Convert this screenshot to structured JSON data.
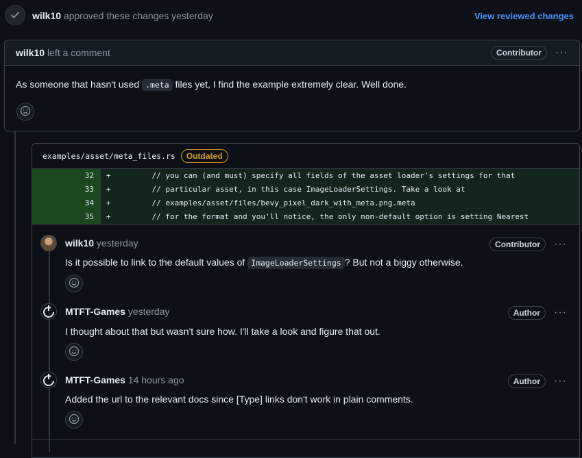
{
  "header": {
    "user": "wilk10",
    "action": "approved these changes yesterday",
    "view_link": "View reviewed changes"
  },
  "top_comment": {
    "user": "wilk10",
    "action": "left a comment",
    "badge": "Contributor",
    "text_before": "As someone that hasn't used",
    "code": ".meta",
    "text_after": "files yet, I find the example extremely clear. Well done."
  },
  "thread": {
    "file_path": "examples/asset/meta_files.rs",
    "status_badge": "Outdated",
    "diff_lines": [
      {
        "num": "32",
        "sign": "+",
        "code": "    // you can (and must) specify all fields of the asset loader's settings for that"
      },
      {
        "num": "33",
        "sign": "+",
        "code": "    // particular asset, in this case ImageLoaderSettings. Take a look at"
      },
      {
        "num": "34",
        "sign": "+",
        "code": "    // examples/asset/files/bevy_pixel_dark_with_meta.png.meta"
      },
      {
        "num": "35",
        "sign": "+",
        "code": "    // for the format and you'll notice, the only non-default option is setting Nearest"
      }
    ],
    "comments": [
      {
        "author": "wilk10",
        "time": "yesterday",
        "badge": "Contributor",
        "text_before": "Is it possible to link to the default values of",
        "code": "ImageLoaderSettings",
        "text_after": "? But not a biggy otherwise."
      },
      {
        "author": "MTFT-Games",
        "time": "yesterday",
        "badge": "Author",
        "text": "I thought about that but wasn't sure how. I'll take a look and figure that out."
      },
      {
        "author": "MTFT-Games",
        "time": "14 hours ago",
        "badge": "Author",
        "text": "Added the url to the relevant docs since [Type] links don't work in plain comments."
      }
    ]
  },
  "colors": {
    "background": "#0d1117",
    "border": "#3d444d",
    "link": "#4493f8",
    "outdated": "#d29922",
    "diff_added_bg": "#12261e",
    "diff_num_bg": "#1b4721"
  },
  "icons": [
    "check-icon",
    "kebab-icon",
    "smiley-icon",
    "avatar-wilk10",
    "avatar-mtft-games"
  ]
}
